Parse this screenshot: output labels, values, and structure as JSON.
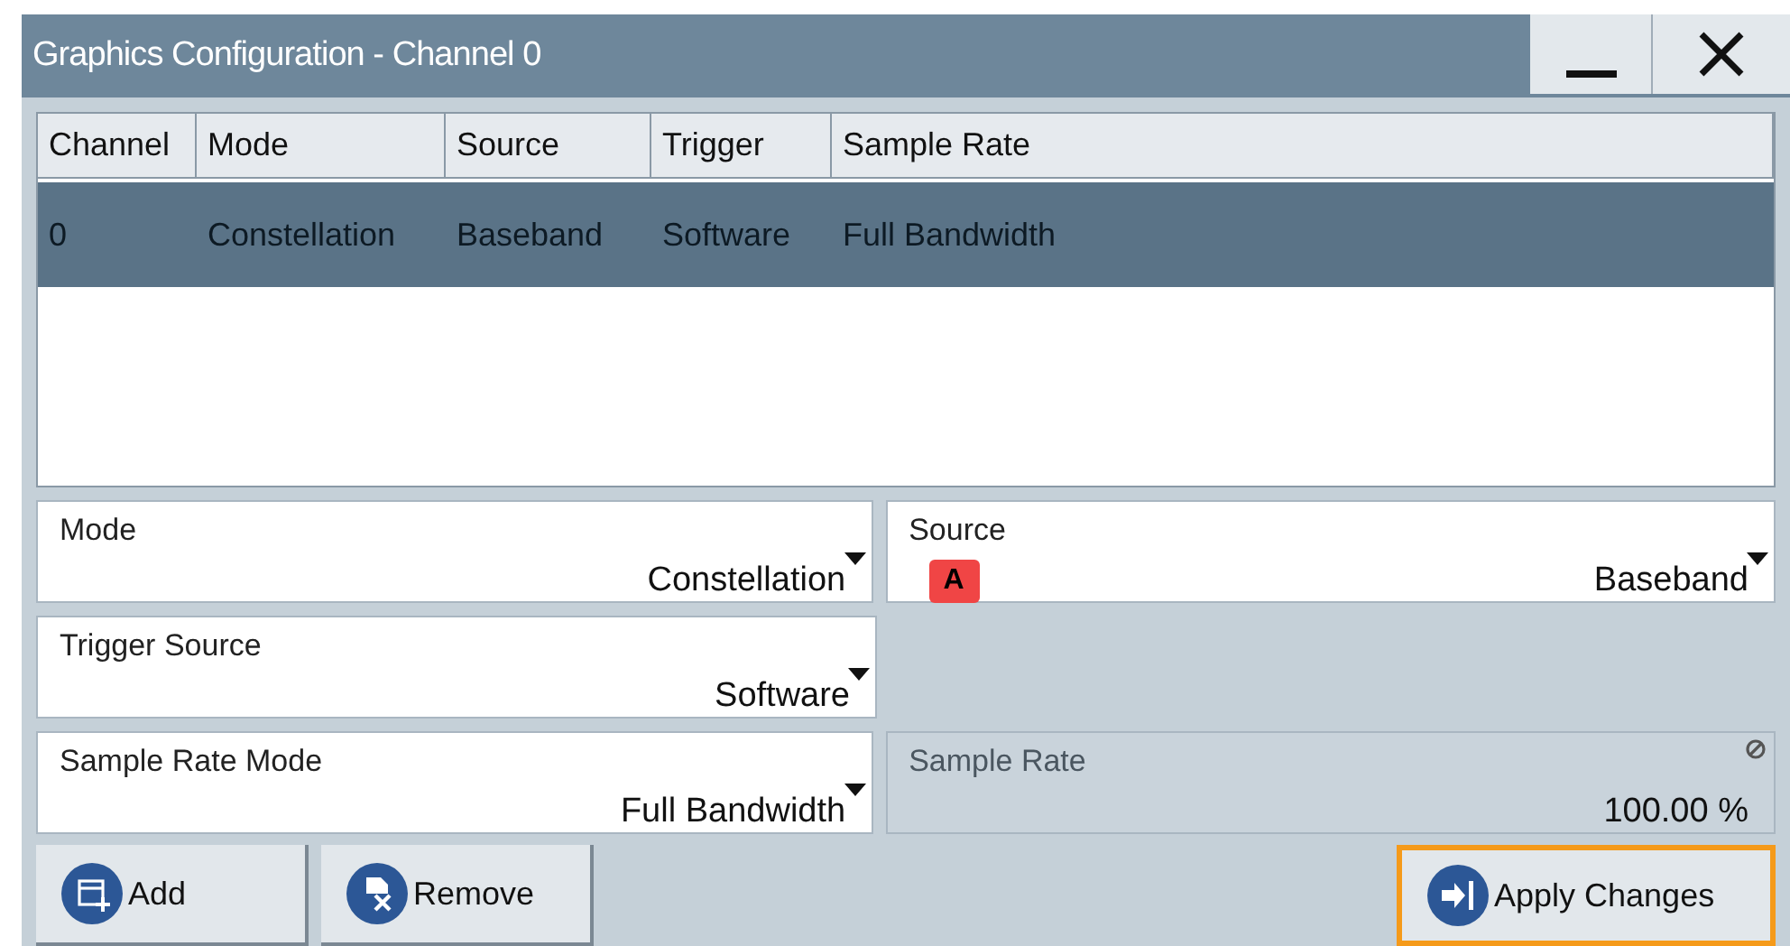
{
  "window": {
    "title": "Graphics Configuration - Channel 0"
  },
  "table": {
    "columns": [
      "Channel",
      "Mode",
      "Source",
      "Trigger",
      "Sample Rate"
    ],
    "rows": [
      {
        "cells": [
          "0",
          "Constellation",
          "Baseband",
          "Software",
          "Full Bandwidth"
        ],
        "selected": true
      }
    ]
  },
  "field_rows": [
    [
      {
        "label": "Mode",
        "value": "Constellation",
        "kind": "select",
        "disabled": false
      },
      {
        "label": "Source",
        "value": "Baseband",
        "kind": "select",
        "badge": "A",
        "disabled": false
      }
    ],
    [
      {
        "label": "Trigger Source",
        "value": "Software",
        "kind": "select",
        "disabled": false
      }
    ],
    [
      {
        "label": "Sample Rate Mode",
        "value": "Full Bandwidth",
        "kind": "select",
        "disabled": false
      },
      {
        "label": "Sample Rate",
        "value": "100.00 %",
        "kind": "number",
        "disabled": true
      }
    ]
  ],
  "buttons": [
    {
      "label": "Add",
      "kind": "add",
      "focused": false
    },
    {
      "label": "Remove",
      "kind": "remove",
      "focused": false
    },
    {
      "label": "Apply Changes",
      "kind": "apply",
      "focused": true
    }
  ]
}
